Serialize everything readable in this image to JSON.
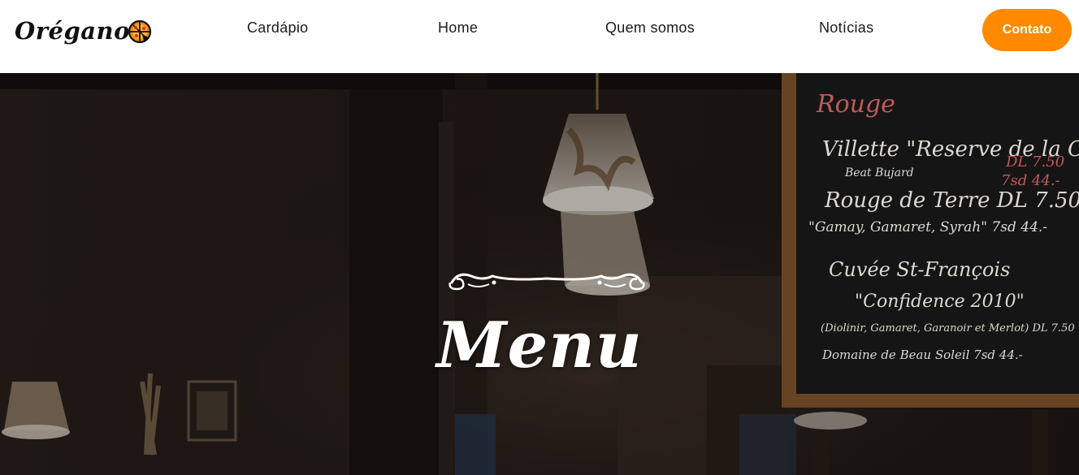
{
  "brand": {
    "name": "Orégano",
    "accent": "#ff8a00"
  },
  "nav": {
    "items": [
      {
        "label": "Cardápio"
      },
      {
        "label": "Home"
      },
      {
        "label": "Quem somos"
      },
      {
        "label": "Notícias"
      }
    ],
    "contact_label": "Contato"
  },
  "hero": {
    "title": "Menu",
    "chalkboard": [
      "Rouge",
      "Villette \"Reserve de la Cave\"",
      "Beat Bujard",
      "DL 7.50",
      "7sd 44.-",
      "Rouge de Terre DL 7.50",
      "\"Gamay, Gamaret, Syrah\" 7sd 44.-",
      "Cuvée St-François",
      "\"Confidence 2010\"",
      "(Diolinir, Gamaret, Garanoir et Merlot) DL 7.50",
      "Domaine de Beau Soleil 7sd 44.-"
    ]
  }
}
